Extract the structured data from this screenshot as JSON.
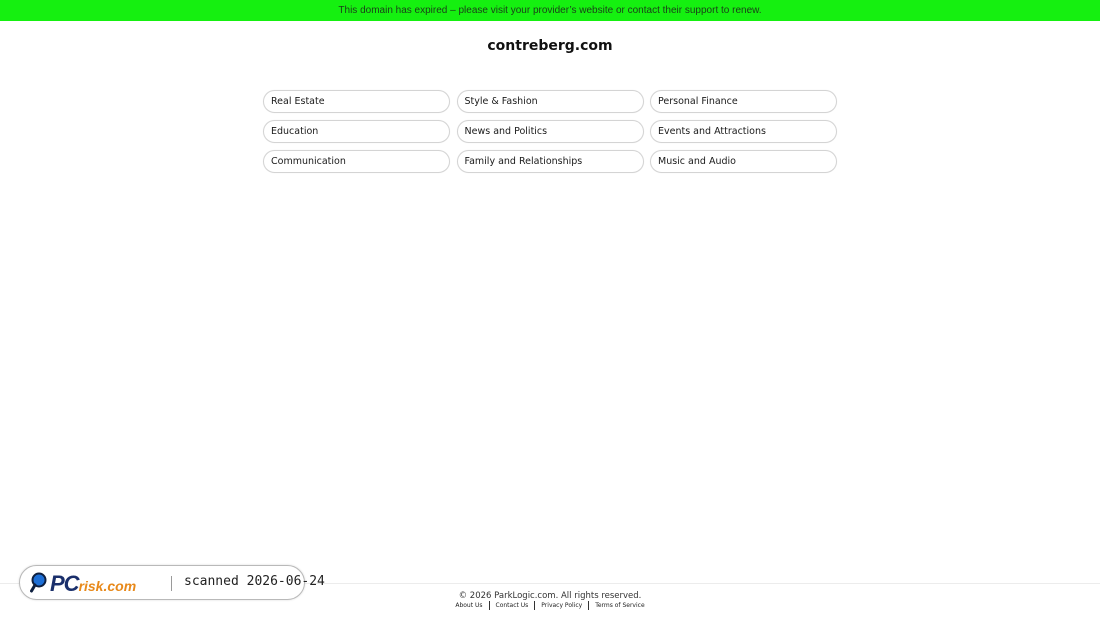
{
  "banner": {
    "message": "This domain has expired – please visit your provider’s website or contact their support to renew.",
    "trailing": ".",
    "color": "#15f010"
  },
  "site": {
    "domain": "contreberg.com"
  },
  "links": [
    "Real Estate",
    "Style & Fashion",
    "Personal Finance",
    "Education",
    "News and Politics",
    "Events and Attractions",
    "Communication",
    "Family and Relationships",
    "Music and Audio"
  ],
  "footer": {
    "copyright": "© 2026 ParkLogic.com. All rights reserved.",
    "links": [
      "About Us",
      "Contact Us",
      "Privacy Policy",
      "Terms of Service"
    ]
  },
  "watermark": {
    "logo_pc": "PC",
    "logo_risk": "risk.com",
    "scan_text": "scanned 2026-06-24",
    "icon": "magnifier-icon"
  }
}
